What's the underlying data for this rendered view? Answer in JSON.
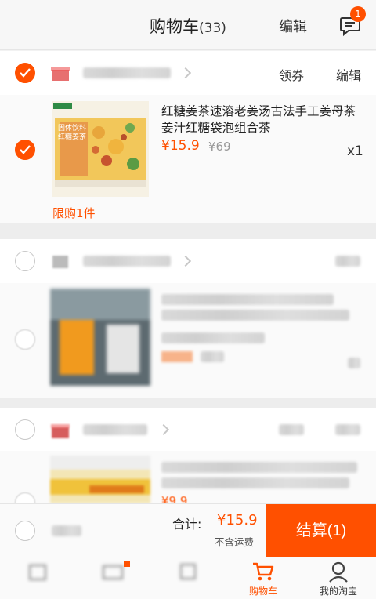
{
  "colors": {
    "accent": "#ff5000",
    "text": "#333333",
    "muted": "#999999"
  },
  "header": {
    "title": "购物车",
    "count": "(33)",
    "edit_label": "编辑",
    "message_badge": "1",
    "message_icon": "chat-bubble-icon"
  },
  "shops": [
    {
      "checked": true,
      "coupon_label": "领券",
      "edit_label": "编辑"
    },
    {
      "checked": false
    },
    {
      "checked": false
    }
  ],
  "item": {
    "title": "红糖姜茶速溶老姜汤古法手工姜母茶姜汁红糖袋泡组合茶",
    "price": "¥15.9",
    "original_price": "¥69",
    "quantity": "x1",
    "limit_note": "限购1件",
    "box_text": "固体饮料 红糖姜茶"
  },
  "item3_price": "¥9.9",
  "checkout": {
    "total_label": "合计:",
    "total_value": "¥15.9",
    "shipping_note": "不含运费",
    "button_label": "结算(1)"
  },
  "tabs": [
    {
      "label": "",
      "icon": "home-icon"
    },
    {
      "label": "",
      "icon": "video-icon"
    },
    {
      "label": "",
      "icon": "messages-icon"
    },
    {
      "label": "购物车",
      "icon": "cart-icon",
      "active": true
    },
    {
      "label": "我的淘宝",
      "icon": "profile-icon"
    }
  ]
}
